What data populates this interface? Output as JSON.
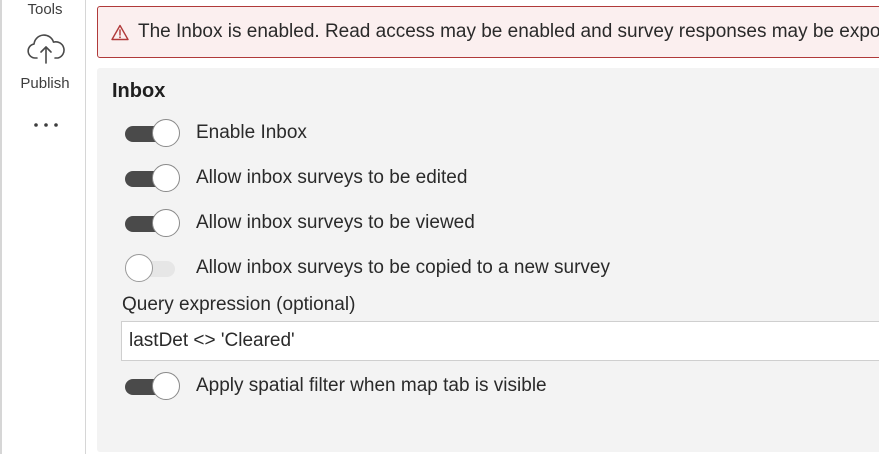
{
  "sidebar": {
    "tools_label": "Tools",
    "publish_label": "Publish",
    "publish_icon": "cloud-upload-icon",
    "more_icon": "more-horizontal-icon"
  },
  "alert": {
    "icon": "warning-triangle-icon",
    "text": "The Inbox is enabled. Read access may be enabled and survey responses may be exposed.",
    "color": "#b03a3a"
  },
  "inbox": {
    "title": "Inbox",
    "toggles": [
      {
        "label": "Enable Inbox",
        "on": true
      },
      {
        "label": "Allow inbox surveys to be edited",
        "on": true
      },
      {
        "label": "Allow inbox surveys to be viewed",
        "on": true
      },
      {
        "label": "Allow inbox surveys to be copied to a new survey",
        "on": false
      }
    ],
    "query_label": "Query expression (optional)",
    "query_value": "lastDet <> 'Cleared'",
    "spatial_toggle": {
      "label": "Apply spatial filter when map tab is visible",
      "on": true
    }
  }
}
